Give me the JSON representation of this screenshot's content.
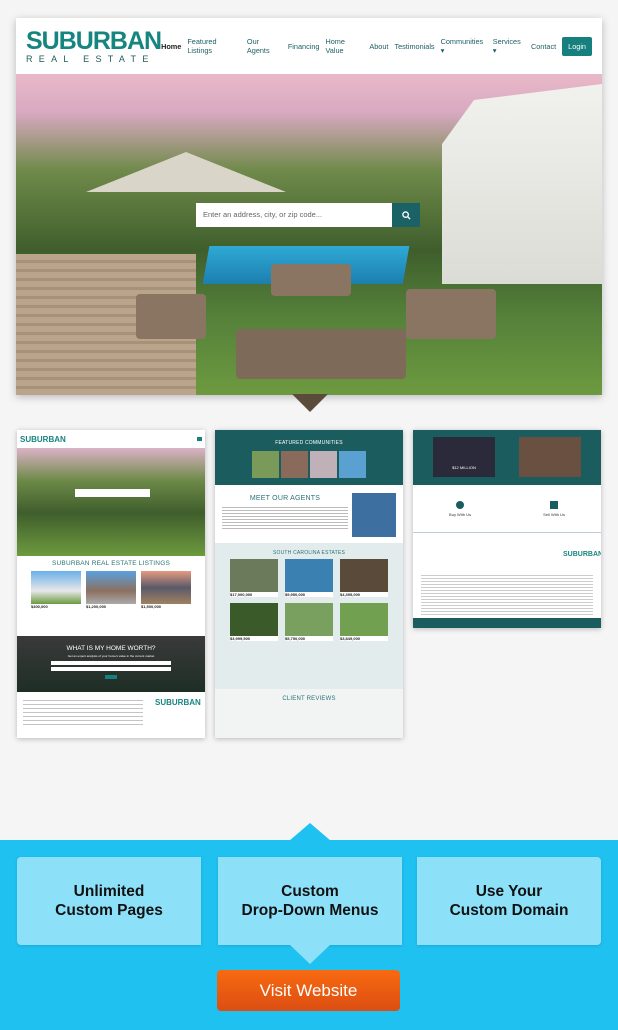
{
  "main_site": {
    "logo": {
      "top": "SUBURBAN",
      "bottom": "REAL ESTATE"
    },
    "nav": [
      "Home",
      "Featured Listings",
      "Our Agents",
      "Financing",
      "Home Value",
      "About",
      "Testimonials",
      "Communities ▾",
      "Services ▾",
      "Contact"
    ],
    "login_label": "Login",
    "search_placeholder": "Enter an address, city, or zip code...",
    "search_icon": "search-icon"
  },
  "thumb1": {
    "listings_title": "SUBURBAN REAL ESTATE LISTINGS",
    "listing_prices": [
      "$400,000",
      "$1,200,000",
      "$1,500,000"
    ],
    "home_worth_title": "WHAT IS MY HOME WORTH?",
    "home_worth_subtitle": "Get an expert analysis of your home's value in the current market"
  },
  "thumb2": {
    "featured_title": "FEATURED COMMUNITIES",
    "agents_title": "MEET OUR AGENTS",
    "estates_title": "SOUTH CAROLINA ESTATES",
    "estate_prices": [
      "$17,000,000",
      "$9,950,000",
      "$4,395,000",
      "$3,999,500",
      "$5,750,000",
      "$3,849,000"
    ],
    "reviews_title": "CLIENT REVIEWS"
  },
  "thumb3": {
    "buy_title": "Buy With Us",
    "sell_title": "Sell With Us",
    "video_caption": "$12 MILLION"
  },
  "features": [
    "Unlimited\nCustom Pages",
    "Custom\nDrop-Down Menus",
    "Use Your\nCustom Domain"
  ],
  "cta_label": "Visit Website",
  "colors": {
    "brand_teal": "#1b5d5f",
    "band_blue": "#1fc1f1",
    "box_blue": "#8ce1f9",
    "cta_orange": "#f05a10"
  }
}
